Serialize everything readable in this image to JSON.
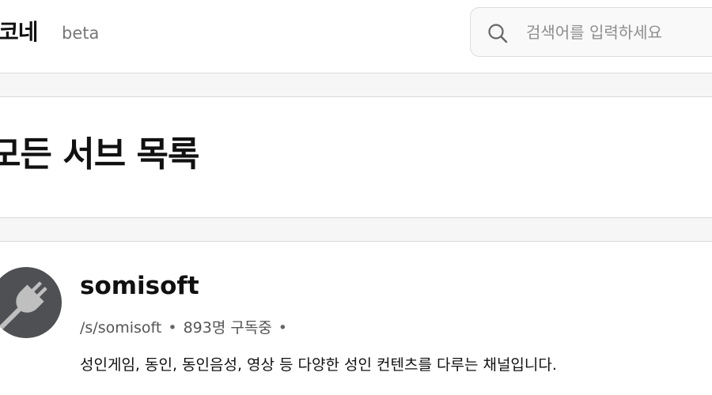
{
  "header": {
    "logo": "코네",
    "beta": "beta",
    "search": {
      "placeholder": "검색어를 입력하세요",
      "icon": "search-icon"
    }
  },
  "main": {
    "title": "모든 서브 목록"
  },
  "channels": [
    {
      "name": "somisoft",
      "path": "/s/somisoft",
      "subscribers": "893명 구독중",
      "separator": "•",
      "description": "성인게임, 동인, 동인음성, 영상 등 다양한 성인 컨텐츠를 다루는 채널입니다.",
      "avatar_icon": "plug-icon",
      "avatar_color": "#4f5054"
    }
  ]
}
